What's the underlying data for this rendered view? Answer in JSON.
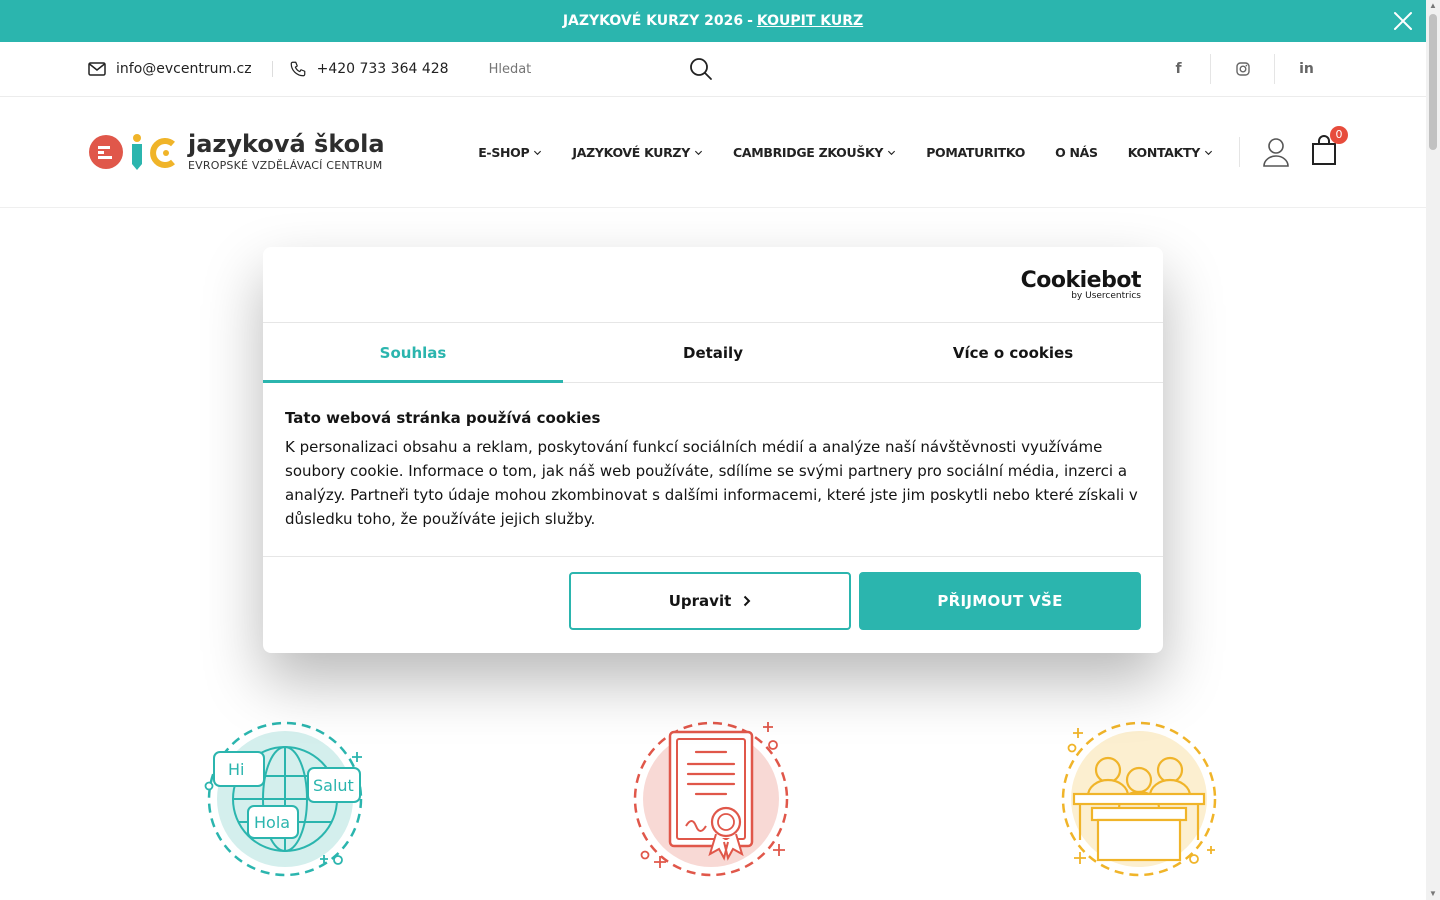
{
  "announcement": {
    "text": "JAZYKOVÉ KURZY 2026",
    "separator": "-",
    "link_label": "KOUPIT KURZ",
    "close_icon": "close-icon"
  },
  "utility": {
    "email": "info@evcentrum.cz",
    "phone": "+420 733 364 428",
    "search_placeholder": "Hledat",
    "social": [
      "facebook-icon",
      "instagram-icon",
      "linkedin-icon"
    ]
  },
  "header": {
    "logo_name": "jazyková škola",
    "logo_sub": "EVROPSKÉ VZDĚLÁVACÍ CENTRUM",
    "nav": [
      {
        "label": "E-SHOP",
        "dropdown": true
      },
      {
        "label": "JAZYKOVÉ KURZY",
        "dropdown": true
      },
      {
        "label": "CAMBRIDGE ZKOUŠKY",
        "dropdown": true
      },
      {
        "label": "POMATURITKO",
        "dropdown": false
      },
      {
        "label": "O NÁS",
        "dropdown": false
      },
      {
        "label": "KONTAKTY",
        "dropdown": true
      }
    ],
    "cart_count": "0"
  },
  "cookie": {
    "brand": "Cookiebot",
    "brand_sub": "by Usercentrics",
    "tabs": [
      "Souhlas",
      "Detaily",
      "Více o cookies"
    ],
    "active_tab": "Souhlas",
    "title": "Tato webová stránka používá cookies",
    "text": "K personalizaci obsahu a reklam, poskytování funkcí sociálních médií a analýze naší návštěvnosti využíváme soubory cookie. Informace o tom, jak náš web používáte, sdílíme se svými partnery pro sociální média, inzerci a analýzy. Partneři tyto údaje mohou zkombinovat s dalšími informacemi, které jste jim poskytli nebo které získali v důsledku toho, že používáte jejich služby.",
    "btn_customize": "Upravit",
    "btn_accept": "PŘIJMOUT VŠE"
  },
  "features": {
    "bubble_1": "Hi",
    "bubble_2": "Salut",
    "bubble_3": "Hola"
  },
  "colors": {
    "accent": "#2bb5ae",
    "red": "#e0574a",
    "yellow": "#f0b429",
    "badge": "#e74c3c"
  }
}
